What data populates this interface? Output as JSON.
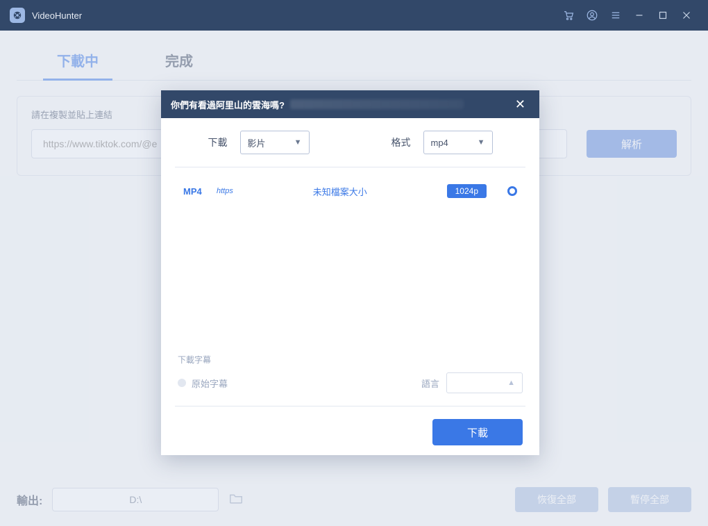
{
  "titlebar": {
    "app_name": "VideoHunter"
  },
  "tabs": {
    "downloading": "下載中",
    "finished": "完成"
  },
  "url_panel": {
    "hint": "請在複製並貼上連結",
    "placeholder": "https://www.tiktok.com/@e",
    "analyze_label": "解析"
  },
  "bottom": {
    "output_label": "輸出:",
    "output_path": "D:\\",
    "resume_all": "恢復全部",
    "pause_all": "暫停全部"
  },
  "modal": {
    "title": "你們有看過阿里山的雲海嗎?",
    "selectors": {
      "download_label": "下載",
      "download_value": "影片",
      "format_label": "格式",
      "format_value": "mp4"
    },
    "result": {
      "format": "MP4",
      "protocol": "https",
      "size_text": "未知檔案大小",
      "quality": "1024p"
    },
    "subtitle": {
      "section_label": "下載字幕",
      "original_label": "原始字幕",
      "language_label": "語言"
    },
    "download_button": "下載"
  }
}
